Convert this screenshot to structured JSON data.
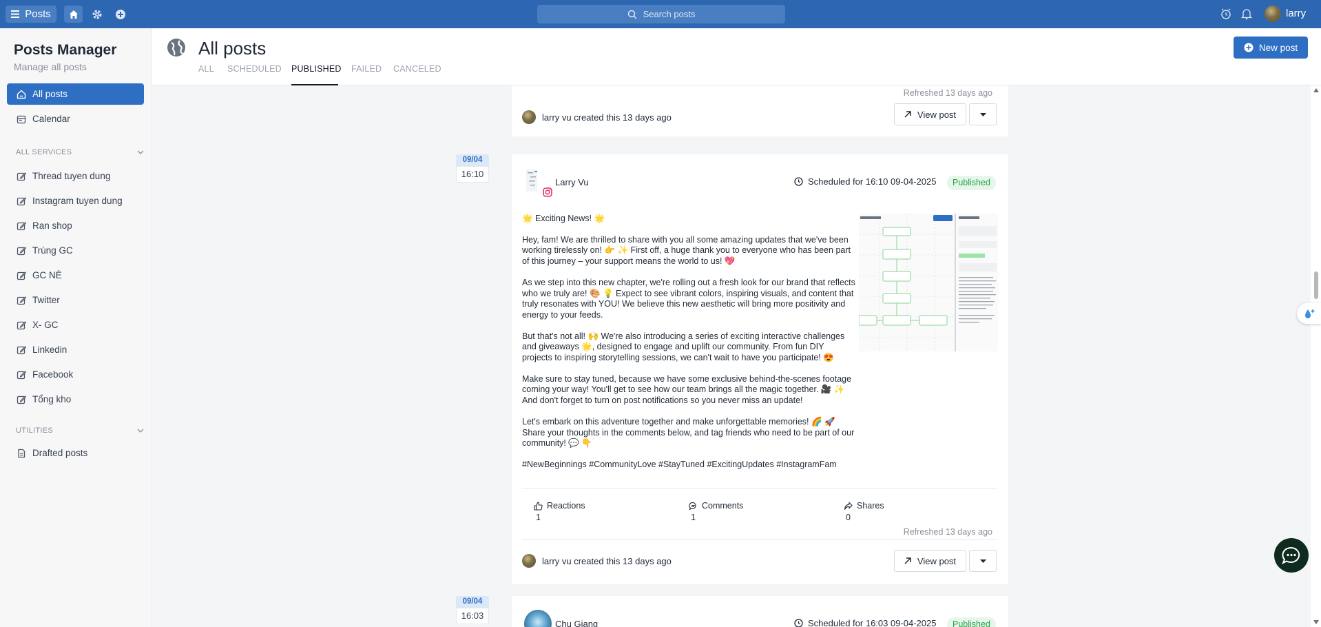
{
  "topbar": {
    "app_label": "Posts",
    "search_placeholder": "Search posts",
    "username": "larry"
  },
  "sidebar": {
    "title": "Posts Manager",
    "subtitle": "Manage all posts",
    "nav": [
      {
        "label": "All posts",
        "icon": "home-icon",
        "active": true
      },
      {
        "label": "Calendar",
        "icon": "calendar-icon",
        "active": false
      }
    ],
    "services_header": "ALL SERVICES",
    "services": [
      "Thread tuyen dung",
      "Instagram tuyen dung",
      "Ran shop",
      "Trùng GC",
      "GC NÈ",
      "Twitter",
      "X- GC",
      "Linkedin",
      "Facebook",
      "Tổng kho"
    ],
    "utilities_header": "UTILITIES",
    "utilities": [
      "Drafted posts"
    ]
  },
  "header": {
    "title": "All posts",
    "tabs": [
      "ALL",
      "SCHEDULED",
      "PUBLISHED",
      "FAILED",
      "CANCELED"
    ],
    "active_tab": "PUBLISHED",
    "new_post_label": "New post"
  },
  "top_card": {
    "refreshed": "Refreshed 13 days ago",
    "created_by": "larry vu created this 13 days ago",
    "view_post": "View post"
  },
  "post1": {
    "date": "09/04",
    "time": "16:10",
    "author": "Larry Vu",
    "scheduled": "Scheduled for 16:10 09-04-2025",
    "status": "Published",
    "paragraphs": [
      "🌟 Exciting News! 🌟",
      "Hey, fam! We are thrilled to share with you all some amazing updates that we've been working tirelessly on! 👉 ✨ First off, a huge thank you to everyone who has been part of this journey – your support means the world to us! 💖",
      "As we step into this new chapter, we're rolling out a fresh look for our brand that reflects who we truly are! 🎨 💡 Expect to see vibrant colors, inspiring visuals, and content that truly resonates with YOU! We believe this new aesthetic will bring more positivity and energy to your feeds.",
      "But that's not all! 🙌 We're also introducing a series of exciting interactive challenges and giveaways 🌟, designed to engage and uplift our community. From fun DIY projects to inspiring storytelling sessions, we can't wait to have you participate! 😍",
      "Make sure to stay tuned, because we have some exclusive behind-the-scenes footage coming your way! You'll get to see how our team brings all the magic together. 🎥 ✨ And don't forget to turn on post notifications so you never miss an update!",
      "Let's embark on this adventure together and make unforgettable memories! 🌈 🚀 Share your thoughts in the comments below, and tag friends who need to be part of our community! 💬 👇",
      "#NewBeginnings #CommunityLove #StayTuned #ExcitingUpdates #InstagramFam"
    ],
    "stats": {
      "reactions_label": "Reactions",
      "reactions": "1",
      "comments_label": "Comments",
      "comments": "1",
      "shares_label": "Shares",
      "shares": "0"
    },
    "refreshed": "Refreshed 13 days ago",
    "created_by": "larry vu created this 13 days ago",
    "view_post": "View post"
  },
  "post2": {
    "date": "09/04",
    "time": "16:03",
    "author": "Chu Giang",
    "scheduled": "Scheduled for 16:03 09-04-2025",
    "status": "Published"
  },
  "colors": {
    "topbar": "#2e67b1",
    "accent": "#2e6fc3",
    "published_bg": "#e6f6ea",
    "published_text": "#27a34a",
    "instagram": "#e1306c"
  }
}
